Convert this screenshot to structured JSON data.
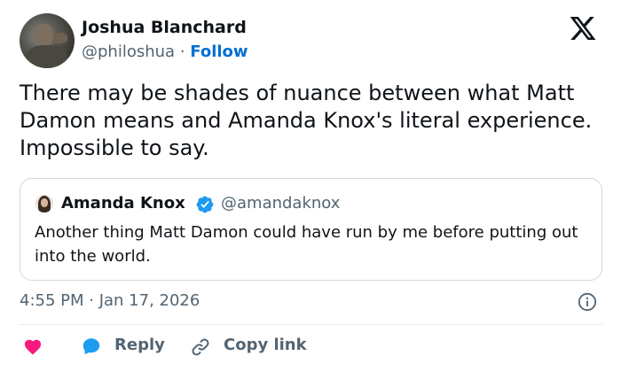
{
  "author": {
    "name": "Joshua Blanchard",
    "handle": "@philoshua",
    "separator": "·",
    "follow_label": "Follow"
  },
  "tweet": {
    "text": "There may be shades of nuance between what Matt Damon means and Amanda Knox's literal experience. Impossible to say."
  },
  "quoted_tweet": {
    "name": "Amanda Knox",
    "handle": "@amandaknox",
    "verified": true,
    "text": "Another thing Matt Damon could have run by me before putting out into the world."
  },
  "meta": {
    "timestamp": "4:55 PM · Jan 17, 2026"
  },
  "actions": {
    "reply_label": "Reply",
    "copy_link_label": "Copy link"
  },
  "icons": {
    "x_logo": "x-logo-icon",
    "verified": "verified-badge-icon",
    "info": "info-icon",
    "like": "heart-icon",
    "reply": "reply-bubble-icon",
    "copy_link": "link-icon"
  },
  "colors": {
    "text": "#0f1419",
    "muted": "#536471",
    "link": "#006fd6",
    "heart": "#f91880",
    "reply_icon": "#1d9bf0",
    "verified": "#1d9bf0",
    "border": "#cfd9de"
  }
}
